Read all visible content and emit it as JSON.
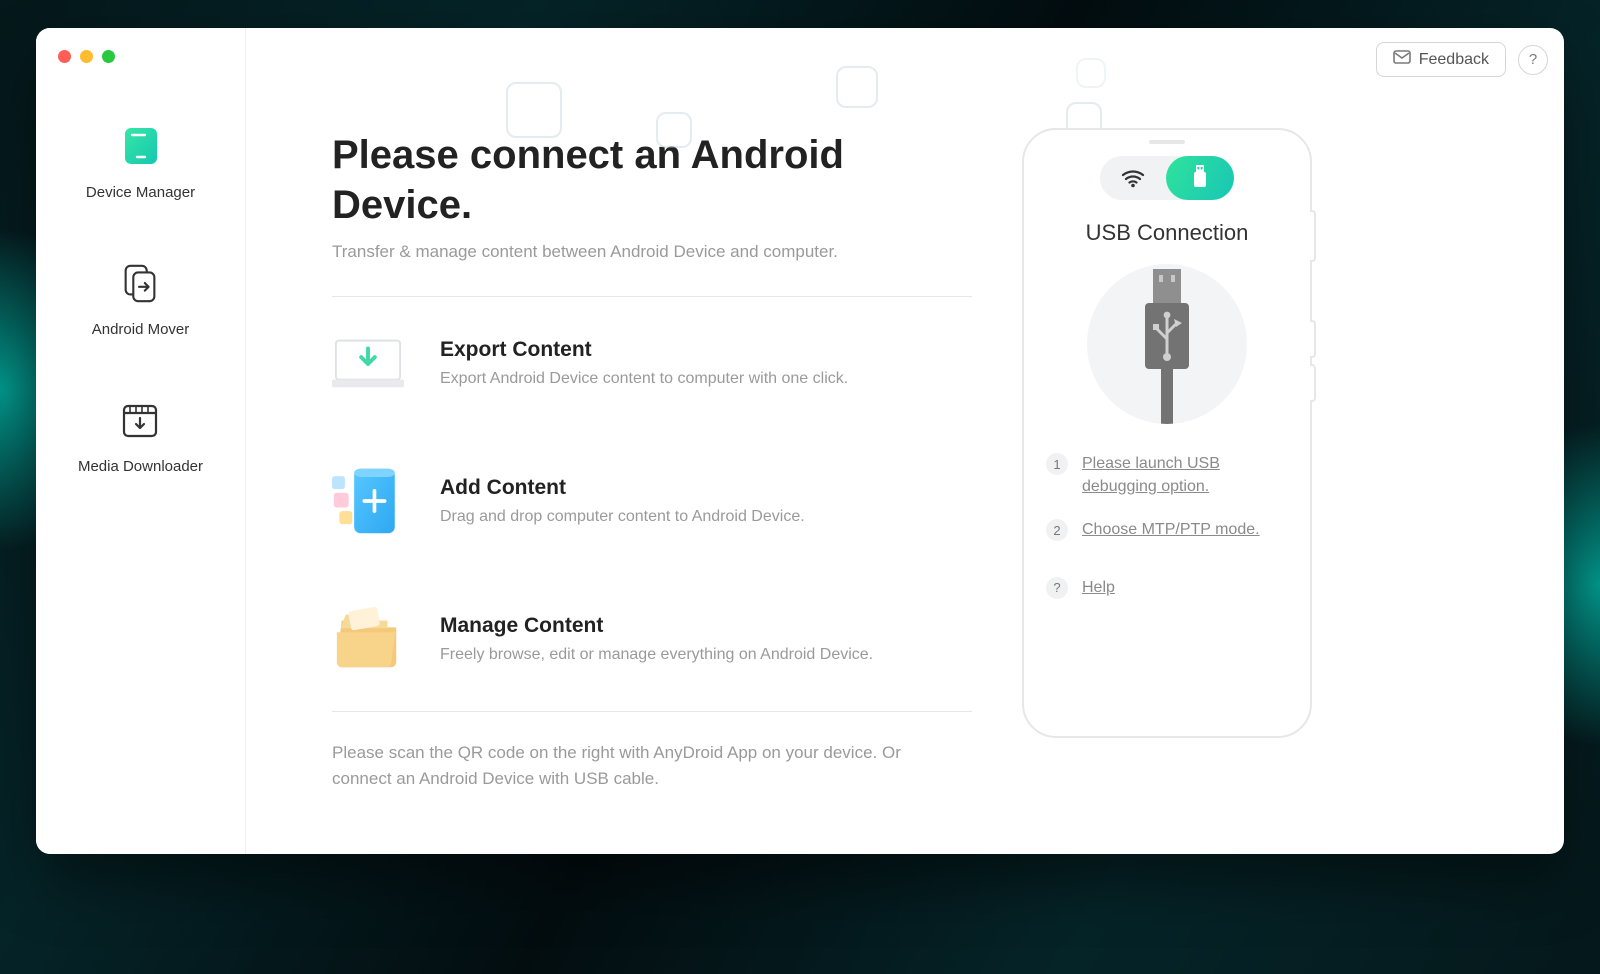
{
  "top": {
    "feedback_label": "Feedback",
    "help_label": "?"
  },
  "sidebar": {
    "items": [
      {
        "label": "Device Manager"
      },
      {
        "label": "Android Mover"
      },
      {
        "label": "Media Downloader"
      }
    ]
  },
  "main": {
    "title": "Please connect an Android Device.",
    "subtitle": "Transfer & manage content between Android Device and computer.",
    "features": [
      {
        "title": "Export Content",
        "desc": "Export Android Device content to computer with one click."
      },
      {
        "title": "Add Content",
        "desc": "Drag and drop computer content to Android Device."
      },
      {
        "title": "Manage Content",
        "desc": "Freely browse, edit or manage everything on Android Device."
      }
    ],
    "footer_note": "Please scan the QR code on the right with AnyDroid App on your device. Or connect an Android Device with USB cable."
  },
  "phone": {
    "connection_title": "USB Connection",
    "steps": [
      {
        "num": "1",
        "text": "Please launch USB debugging option."
      },
      {
        "num": "2",
        "text": "Choose MTP/PTP mode."
      },
      {
        "num": "?",
        "text": "Help"
      }
    ]
  }
}
